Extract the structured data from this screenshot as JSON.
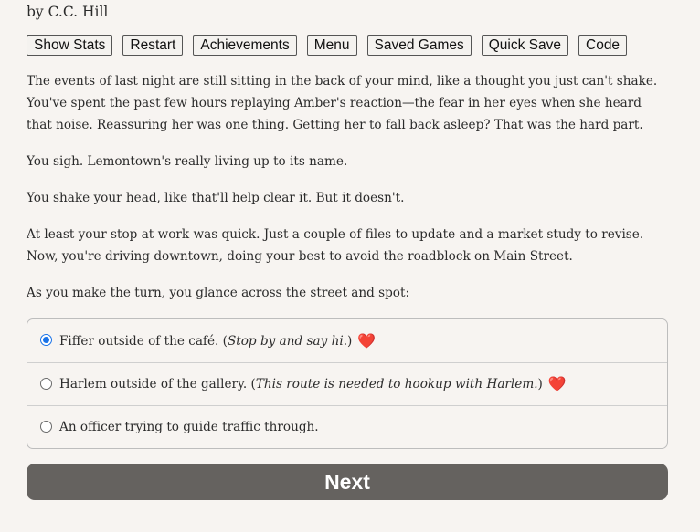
{
  "author": "by C.C. Hill",
  "toolbar": {
    "show_stats": "Show Stats",
    "restart": "Restart",
    "achievements": "Achievements",
    "menu": "Menu",
    "saved_games": "Saved Games",
    "quick_save": "Quick Save",
    "code": "Code"
  },
  "story": {
    "p1": "The events of last night are still sitting in the back of your mind, like a thought you just can't shake. You've spent the past few hours replaying Amber's reaction—the fear in her eyes when she heard that noise. Reassuring her was one thing. Getting her to fall back asleep? That was the hard part.",
    "p2": "You sigh. Lemontown's really living up to its name.",
    "p3": "You shake your head, like that'll help clear it. But it doesn't.",
    "p4": "At least your stop at work was quick. Just a couple of files to update and a market study to revise. Now, you're driving downtown, doing your best to avoid the roadblock on Main Street.",
    "p5": "As you make the turn, you glance across the street and spot:"
  },
  "choices": [
    {
      "label": "Fiffer outside of the café. (",
      "hint": "Stop by and say hi.",
      "close": ")",
      "heart": "❤️",
      "selected": true
    },
    {
      "label": "Harlem outside of the gallery. (",
      "hint": "This route is needed to hookup with Harlem.",
      "close": ")",
      "heart": "❤️",
      "selected": false
    },
    {
      "label": "An officer trying to guide traffic through.",
      "selected": false
    }
  ],
  "next_label": "Next",
  "colors": {
    "background": "#f7f4f1",
    "next_button": "#65625f",
    "radio_selected": "#1a73e8",
    "heart": "#e53935"
  }
}
